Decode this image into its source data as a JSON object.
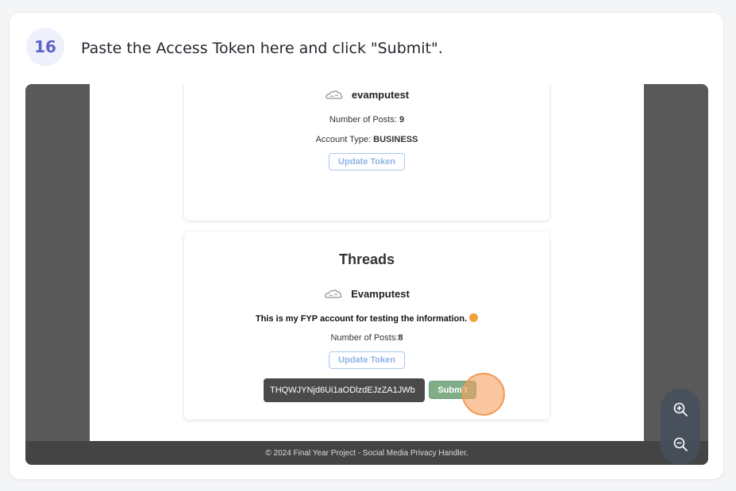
{
  "step": {
    "number": "16",
    "instruction": "Paste the Access Token here and click \"Submit\"."
  },
  "instagram_card": {
    "username": "evamputest",
    "posts_label": "Number of Posts: ",
    "posts_value": "9",
    "type_label": "Account Type: ",
    "type_value": "BUSINESS",
    "update_button": "Update Token"
  },
  "threads_card": {
    "title": "Threads",
    "username": "Evamputest",
    "bio": "This is my FYP account for testing the information.",
    "posts_label": "Number of Posts:",
    "posts_value": "8",
    "update_button": "Update Token",
    "token_value": "THQWJYNjd6Ui1aODlzdEJzZA1JWb",
    "submit_button": "Submit"
  },
  "footer": {
    "text": "© 2024 Final Year Project - Social Media Privacy Handler."
  },
  "icons": {
    "avatar": "cloud-avatar-icon",
    "zoom_in": "zoom-in-icon",
    "zoom_out": "zoom-out-icon",
    "bio_emoji": "smiley-emoji-icon"
  },
  "colors": {
    "step_badge_text": "#5a63c8",
    "submit": "#7fae88",
    "update_border": "#a9c8ef",
    "highlight": "#f39a56"
  }
}
